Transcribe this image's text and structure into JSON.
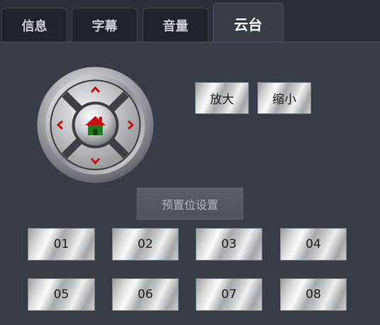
{
  "tabs": [
    {
      "label": "信息"
    },
    {
      "label": "字幕"
    },
    {
      "label": "音量"
    },
    {
      "label": "云台"
    }
  ],
  "active_tab": "云台",
  "zoom": {
    "in_label": "放大",
    "out_label": "缩小"
  },
  "preset_settings_label": "预置位设置",
  "presets": [
    {
      "label": "01"
    },
    {
      "label": "02"
    },
    {
      "label": "03"
    },
    {
      "label": "04"
    },
    {
      "label": "05"
    },
    {
      "label": "06"
    },
    {
      "label": "07"
    },
    {
      "label": "08"
    }
  ],
  "colors": {
    "panel_bg": "#363d47",
    "arrow": "#c81010",
    "home_roof": "#c81010",
    "home_body": "#1f7a1f"
  }
}
